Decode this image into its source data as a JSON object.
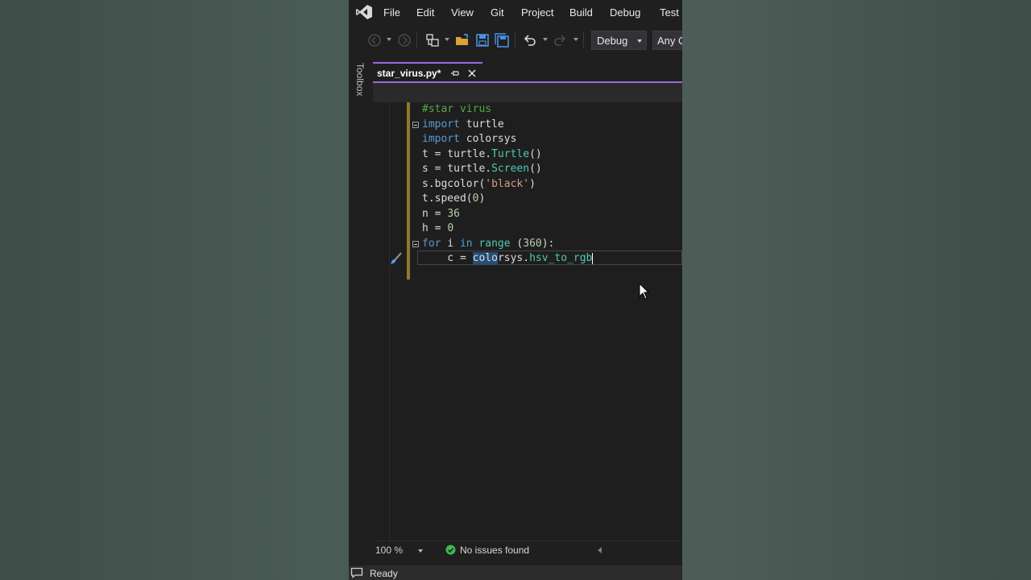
{
  "menu": {
    "items": [
      "File",
      "Edit",
      "View",
      "Git",
      "Project",
      "Build",
      "Debug",
      "Test"
    ]
  },
  "toolbar": {
    "configuration": "Debug",
    "platform": "Any C"
  },
  "toolbox": {
    "label": "Toolbox"
  },
  "tab": {
    "title": "star_virus.py*"
  },
  "editor": {
    "lines": [
      "#star virus",
      "import turtle",
      "import colorsys",
      "t = turtle.Turtle()",
      "s = turtle.Screen()",
      "s.bgcolor('black')",
      "t.speed(0)",
      "n = 36",
      "h = 0",
      "for i in range (360):",
      "    c = colorsys.hsv_to_rgb"
    ]
  },
  "status": {
    "zoom": "100 %",
    "issues": "No issues found",
    "ready": "Ready"
  },
  "colors": {
    "accent": "#9a6bdc",
    "keyword": "#569cd6",
    "comment": "#57a64a",
    "string": "#d69d85",
    "number": "#b5cea8",
    "type": "#4ec9b0",
    "ok": "#3fb950"
  },
  "icons": [
    "visual-studio-logo",
    "back-icon",
    "forward-icon",
    "solution-explorer-icon",
    "open-folder-icon",
    "save-icon",
    "save-all-icon",
    "undo-icon",
    "redo-icon",
    "pin-icon",
    "close-icon",
    "brush-icon",
    "check-circle-icon",
    "mouse-cursor-icon",
    "comment-icon"
  ]
}
